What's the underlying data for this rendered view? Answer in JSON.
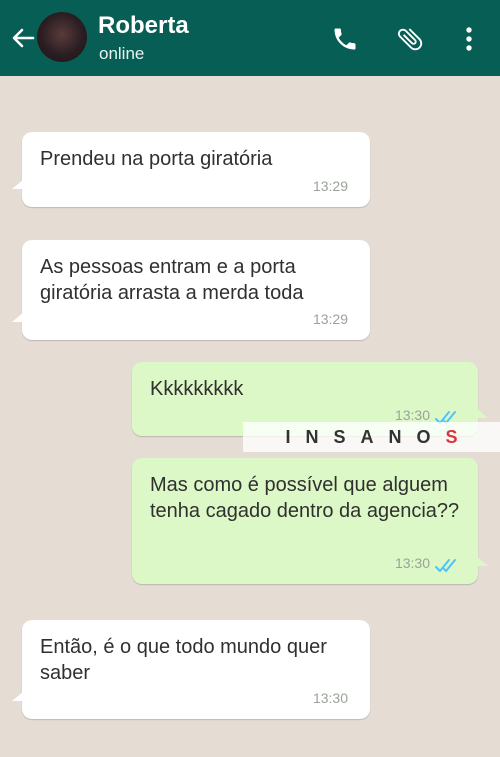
{
  "header": {
    "contact_name": "Roberta",
    "status": "online",
    "icons": [
      "back-arrow-icon",
      "avatar",
      "phone-icon",
      "attach-icon",
      "menu-icon"
    ],
    "bg_color": "#075e54"
  },
  "messages": [
    {
      "direction": "incoming",
      "text": "Prendeu na porta giratória",
      "time": "13:29"
    },
    {
      "direction": "incoming",
      "text": "As pessoas entram e a porta giratória arrasta a merda toda",
      "time": "13:29"
    },
    {
      "direction": "outgoing",
      "text": "Kkkkkkkkk",
      "time": "13:30",
      "read": true
    },
    {
      "direction": "outgoing",
      "text": "Mas como é possível que alguem tenha cagado dentro da agencia??",
      "time": "13:30",
      "read": true
    },
    {
      "direction": "incoming",
      "text": "Então, é o que todo mundo quer saber",
      "time": "13:30"
    }
  ],
  "watermark": {
    "text": "INSANO",
    "logo": "S"
  },
  "colors": {
    "incoming": "#ffffff",
    "outgoing": "#dcf8c6",
    "read_ticks": "#4fc3f7"
  }
}
